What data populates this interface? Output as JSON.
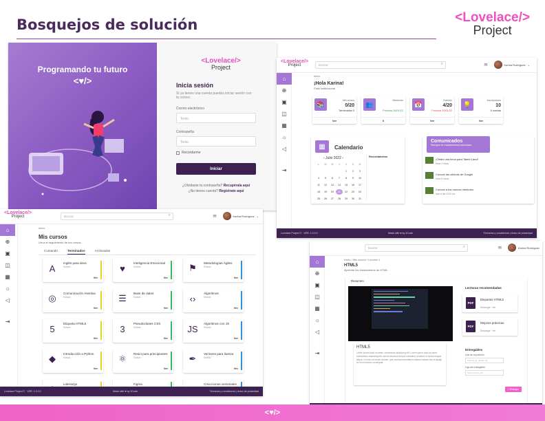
{
  "page": {
    "title": "Bosquejos de solución",
    "brand_line1": "<Lovelace/>",
    "brand_line2": "Project",
    "bottom_logo": "<♥/>"
  },
  "login": {
    "hero_title": "Programando tu futuro",
    "hero_logo": "<♥/>",
    "brand_line1": "<Lovelace/>",
    "brand_line2": "Project",
    "heading": "Inicia sesión",
    "subtitle": "Si ya tienes una cuenta puedes iniciar sesión con tu correo.",
    "email_label": "Correo electrónico",
    "email_placeholder": "Texto",
    "password_label": "Contraseña",
    "password_placeholder": "Texto",
    "remember": "Recordarme",
    "submit": "Iniciar",
    "forgot_text": "¿Olvidaste tu contraseña?",
    "forgot_link": "Recupérala aquí",
    "register_text": "¿No tienes cuenta?",
    "register_link": "Regístrate aquí"
  },
  "app": {
    "brand_line1": "<Lovelace/>",
    "brand_line2": "Project",
    "search_placeholder": "Buscar",
    "user_name": "Karina Rodríguez",
    "footer_left": "Lovelace Project ©",
    "footer_version": "VER. 1.0.0.0",
    "footer_center": "Made with ♥ by 3Code",
    "footer_right": "Términos y condiciones | Aviso de privacidad",
    "sidebar_icons": [
      "⌂",
      "⊕",
      "▣",
      "◫",
      "▦",
      "☼",
      "◁",
      "⇥"
    ]
  },
  "dashboard": {
    "breadcrumb": "Inicio",
    "greeting": "¡Hola Karina!",
    "phase": "Fase institucional",
    "cards": [
      {
        "label": "Mis cursos",
        "value": "0/20",
        "sub": "Terminados 0",
        "sub_color": "#333333",
        "action": "Ver",
        "icon": "📚"
      },
      {
        "label": "Mentorías",
        "value": "",
        "sub": "Próxima 26/01/22",
        "sub_color": "#2e9e4f",
        "action": "0",
        "icon": "👥"
      },
      {
        "label": "Eventos",
        "value": "4/20",
        "sub": "Próxima 20/01/22",
        "sub_color": "#d94a4a",
        "action": "Ver",
        "icon": "📅"
      },
      {
        "label": "Inscripciones",
        "value": "10",
        "sub": "5 nuevas",
        "sub_color": "#333333",
        "action": "Ver",
        "icon": "💡"
      }
    ],
    "calendar_title": "Calendario",
    "calendar_month": "‹   Julio 2022   ›",
    "calendar_side": "Recordatorios",
    "weekdays": [
      "L",
      "M",
      "M",
      "J",
      "V",
      "S",
      "D"
    ],
    "days": [
      "",
      "",
      "",
      "",
      "1",
      "2",
      "3",
      "4",
      "5",
      "6",
      "7",
      "8",
      "9",
      "10",
      "11",
      "12",
      "13",
      "14",
      "15",
      "16",
      "17",
      "18",
      "19",
      "20",
      "21",
      "22",
      "23",
      "24",
      "25",
      "26",
      "27",
      "28",
      "29",
      "30",
      "31"
    ],
    "selected_day": "21",
    "news_title": "Comunicados",
    "news_sub": "Siempre te mantenemos informado",
    "news": [
      {
        "title": "¡Obtén una beca para Talent Land!",
        "time": "Hace 2 horas"
      },
      {
        "title": "Conoce las oficinas de Google",
        "time": "Hace 5 horas"
      },
      {
        "title": "Conoce a los nuevos mentores",
        "time": "Ayer a las 12:00 hrs"
      }
    ]
  },
  "courses": {
    "breadcrumb": "Inicio",
    "title": "Mis cursos",
    "subtitle": "Lleva el seguimiento de tus cursos.",
    "tabs": [
      "Cursando",
      "Terminados",
      "Archivados"
    ],
    "active_tab": 1,
    "status": "Estado",
    "action": "Ver",
    "items": [
      {
        "name": "Inglés para devs",
        "icon": "A",
        "color": "#e6d619"
      },
      {
        "name": "Inteligencia Emocional",
        "icon": "♥",
        "color": "#2dbf5b"
      },
      {
        "name": "Metodologías Ágiles",
        "icon": "⚑",
        "color": "#2f8fdc"
      },
      {
        "name": "Comunicación Asertiva",
        "icon": "◎",
        "color": "#e6d619"
      },
      {
        "name": "Base de datos",
        "icon": "☰",
        "color": "#2dbf5b"
      },
      {
        "name": "Algoritmos",
        "icon": "‹›",
        "color": "#2f8fdc"
      },
      {
        "name": "Etiqueta HTML5",
        "icon": "5",
        "color": "#e6d619"
      },
      {
        "name": "Pseudoclases CSS",
        "icon": "3",
        "color": "#2dbf5b"
      },
      {
        "name": "Algoritmos con JS",
        "icon": "JS",
        "color": "#2f8fdc"
      },
      {
        "name": "Introducción a Python",
        "icon": "◆",
        "color": "#e6d619"
      },
      {
        "name": "React para principiantes",
        "icon": "⚛",
        "color": "#2dbf5b"
      },
      {
        "name": "Vectores para ilustrar",
        "icon": "✒",
        "color": "#2f8fdc"
      },
      {
        "name": "Liderazgo",
        "icon": "◎",
        "color": "#e6d619"
      },
      {
        "name": "Figma",
        "icon": "A",
        "color": "#2dbf5b"
      },
      {
        "name": "Crea iconos vectoriales",
        "icon": "⚬",
        "color": "#2f8fdc"
      }
    ]
  },
  "lesson": {
    "breadcrumb": "Inicio / Mis cursos / Lección 1",
    "title": "HTML5",
    "subtitle": "Aprende los fundamentos de HTML.",
    "tab": "Resumen",
    "heading": "HTML5",
    "body": "Lorem ipsum dolor sit amet, consectetur adipiscing elit. Lorem ipsum dolor sit amet, consectetur adipiscing elit, sed do eiusmod tempor incididunt ut labore et dolore magna aliqua. Ut enim ad minim veniam, quis nostrud exercitation ullamco laboris nisi ut aliquip ex ea commodo consequat.",
    "readings_title": "Lecturas recomendadas",
    "readings": [
      {
        "name": "Etiquetas HTML5",
        "meta": "Descargar · Ver"
      },
      {
        "name": "Mejores prácticas",
        "meta": "Descargar · Ver"
      }
    ],
    "pdf_label": "PDF",
    "deliverables": "Entregables",
    "repo_label": "Link de repositorio",
    "repo_placeholder": "Link del git, github, etc.",
    "deploy_label": "Liga del entregable",
    "deploy_placeholder": "Subir archivo pdf",
    "submit": "+ Entregar"
  }
}
